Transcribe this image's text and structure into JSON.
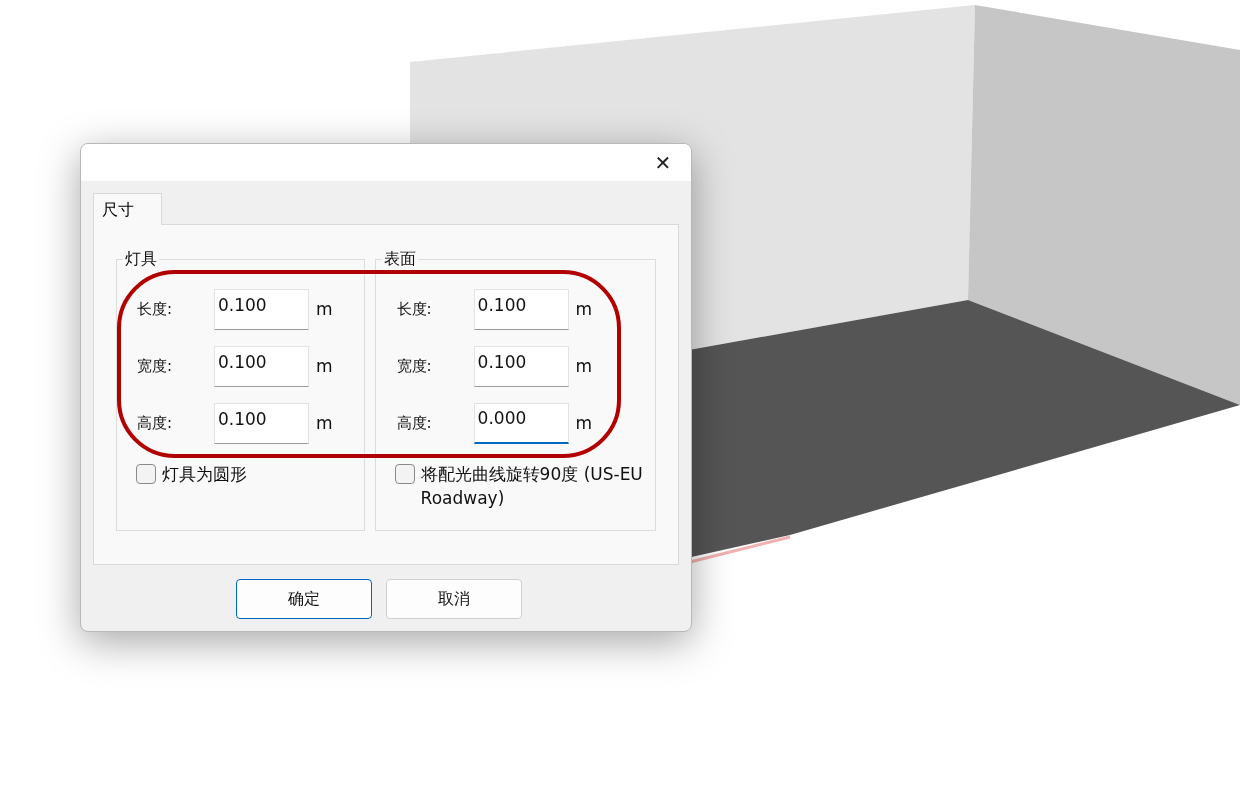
{
  "dialog": {
    "close": "✕",
    "tabs": [
      {
        "label": "尺寸",
        "selected": true
      }
    ],
    "groups": [
      {
        "title": "灯具",
        "fields": [
          {
            "label": "长度:",
            "value": "0.100",
            "unit": "m",
            "focused": false
          },
          {
            "label": "宽度:",
            "value": "0.100",
            "unit": "m",
            "focused": false
          },
          {
            "label": "高度:",
            "value": "0.100",
            "unit": "m",
            "focused": false
          }
        ],
        "checkbox": {
          "label": "灯具为圆形",
          "checked": false
        }
      },
      {
        "title": "表面",
        "fields": [
          {
            "label": "长度:",
            "value": "0.100",
            "unit": "m",
            "focused": false
          },
          {
            "label": "宽度:",
            "value": "0.100",
            "unit": "m",
            "focused": false
          },
          {
            "label": "高度:",
            "value": "0.000",
            "unit": "m",
            "focused": true
          }
        ],
        "checkbox": {
          "label": "将配光曲线旋转90度 (US-EU Roadway)",
          "checked": false
        }
      }
    ],
    "buttons": [
      {
        "label": "确定",
        "default": true
      },
      {
        "label": "取消",
        "default": false
      }
    ]
  }
}
